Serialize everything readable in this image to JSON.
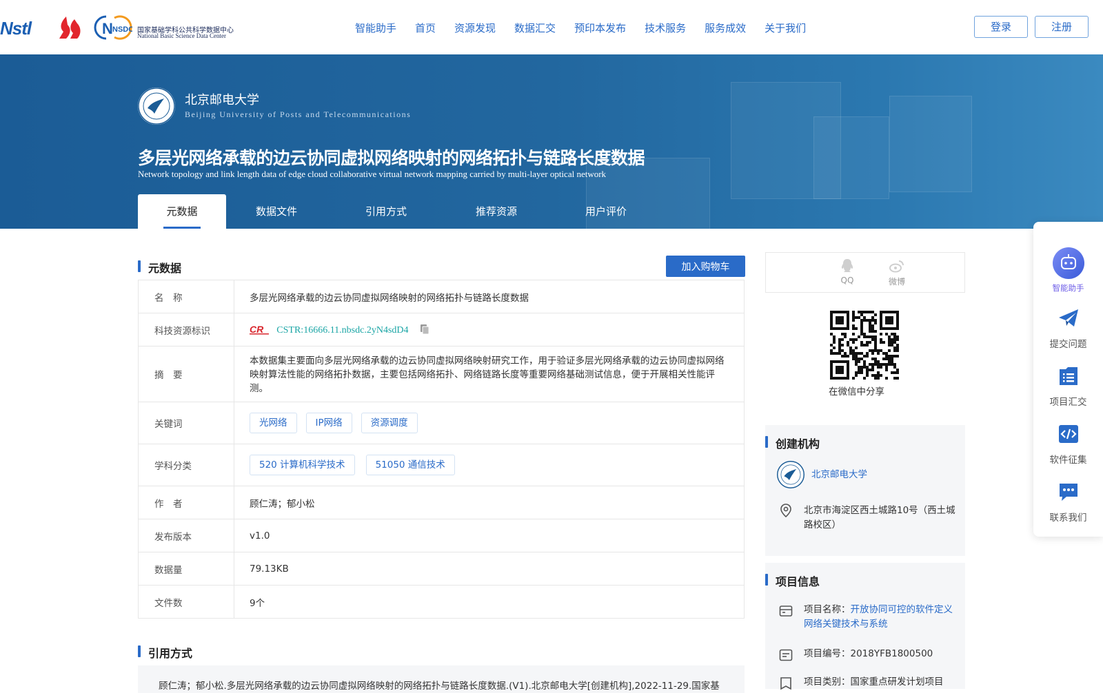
{
  "header": {
    "logo_nstl": "Nstl",
    "nsdc": {
      "mark": "NSDC",
      "cn": "国家基础学科公共科学数据中心",
      "en": "National Basic Science Data Center"
    },
    "nav": [
      "智能助手",
      "首页",
      "资源发现",
      "数据汇交",
      "预印本发布",
      "技术服务",
      "服务成效",
      "关于我们"
    ],
    "login": "登录",
    "register": "注册"
  },
  "banner": {
    "inst_cn": "北京邮电大学",
    "inst_en": "Beijing University of Posts and Telecommunications",
    "title": "多层光网络承载的边云协同虚拟网络映射的网络拓扑与链路长度数据",
    "title_en": "Network topology and link length data of edge cloud collaborative virtual network mapping carried by multi-layer optical network",
    "tabs": [
      "元数据",
      "数据文件",
      "引用方式",
      "推荐资源",
      "用户评价"
    ]
  },
  "metadata": {
    "heading": "元数据",
    "cart": "加入购物车",
    "rows": {
      "name": {
        "k": "名　称",
        "v": "多层光网络承载的边云协同虚拟网络映射的网络拓扑与链路长度数据"
      },
      "cstr": {
        "k": "科技资源标识",
        "v": "CSTR:16666.11.nbsdc.2yN4sdD4"
      },
      "abstract": {
        "k": "摘　要",
        "v": "本数据集主要面向多层光网络承载的边云协同虚拟网络映射研究工作，用于验证多层光网络承载的边云协同虚拟网络映射算法性能的网络拓扑数据，主要包括网络拓扑、网络链路长度等重要网络基础测试信息，便于开展相关性能评测。"
      },
      "keywords": {
        "k": "关键词",
        "items": [
          "光网络",
          "IP网络",
          "资源调度"
        ]
      },
      "subjects": {
        "k": "学科分类",
        "items": [
          "520 计算机科学技术",
          "51050 通信技术"
        ]
      },
      "authors": {
        "k": "作　者",
        "v": "顾仁涛；郁小松"
      },
      "version": {
        "k": "发布版本",
        "v": "v1.0"
      },
      "size": {
        "k": "数据量",
        "v": "79.13KB"
      },
      "files": {
        "k": "文件数",
        "v": "9个"
      }
    }
  },
  "citation": {
    "heading": "引用方式",
    "text": "顾仁涛；郁小松.多层光网络承载的边云协同虚拟网络映射的网络拓扑与链路长度数据.(V1).北京邮电大学[创建机构],2022-11-29.国家基"
  },
  "share": {
    "qq": "QQ",
    "weibo": "微博",
    "wechat": "在微信中分享"
  },
  "creator": {
    "heading": "创建机构",
    "name": "北京邮电大学",
    "address": "北京市海淀区西土城路10号（西土城路校区）"
  },
  "project": {
    "heading": "项目信息",
    "name_label": "项目名称：",
    "name_value": "开放协同可控的软件定义网络关键技术与系统",
    "no": "项目编号：2018YFB1800500",
    "type": "项目类别：国家重点研发计划项目"
  },
  "floatbar": [
    "智能助手",
    "提交问题",
    "项目汇交",
    "软件征集",
    "联系我们"
  ],
  "colors": {
    "primary": "#2a6bc8",
    "banner": "#1b5c96",
    "cstr": "#1aa5a5",
    "assistant": "#6c5ce7"
  }
}
